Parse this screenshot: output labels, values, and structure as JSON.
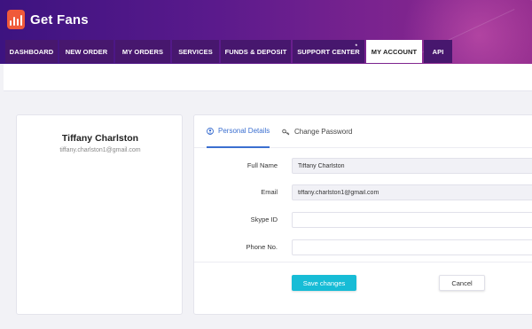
{
  "brand": {
    "name": "Get Fans"
  },
  "nav": {
    "tabs": [
      {
        "label": "DASHBOARD"
      },
      {
        "label": "NEW ORDER"
      },
      {
        "label": "MY ORDERS"
      },
      {
        "label": "SERVICES"
      },
      {
        "label": "FUNDS & DEPOSIT"
      },
      {
        "label": "SUPPORT CENTER"
      },
      {
        "label": "MY ACCOUNT"
      },
      {
        "label": "API"
      }
    ],
    "active": "MY ACCOUNT",
    "support_badge": "*"
  },
  "profile": {
    "name": "Tiffany Charlston",
    "email": "tiffany.charlston1@gmail.com"
  },
  "form": {
    "tabs": {
      "personal": "Personal Details",
      "password": "Change Password"
    },
    "fields": {
      "full_name": {
        "label": "Full Name",
        "value": "Tiffany Charlston"
      },
      "email": {
        "label": "Email",
        "value": "tiffany.charlston1@gmail.com"
      },
      "skype": {
        "label": "Skype ID",
        "value": ""
      },
      "phone": {
        "label": "Phone No.",
        "value": ""
      }
    },
    "save_label": "Save changes",
    "cancel_label": "Cancel"
  },
  "colors": {
    "header_start": "#3d1380",
    "header_end": "#8f2a8c",
    "logo_badge": "#f05a3a",
    "active_tab_text": "#3b6fd0",
    "save_button": "#17bcd6"
  },
  "icons": {
    "logo": "bar-chart-icon",
    "personal_tab": "user-icon",
    "password_tab": "key-icon"
  }
}
